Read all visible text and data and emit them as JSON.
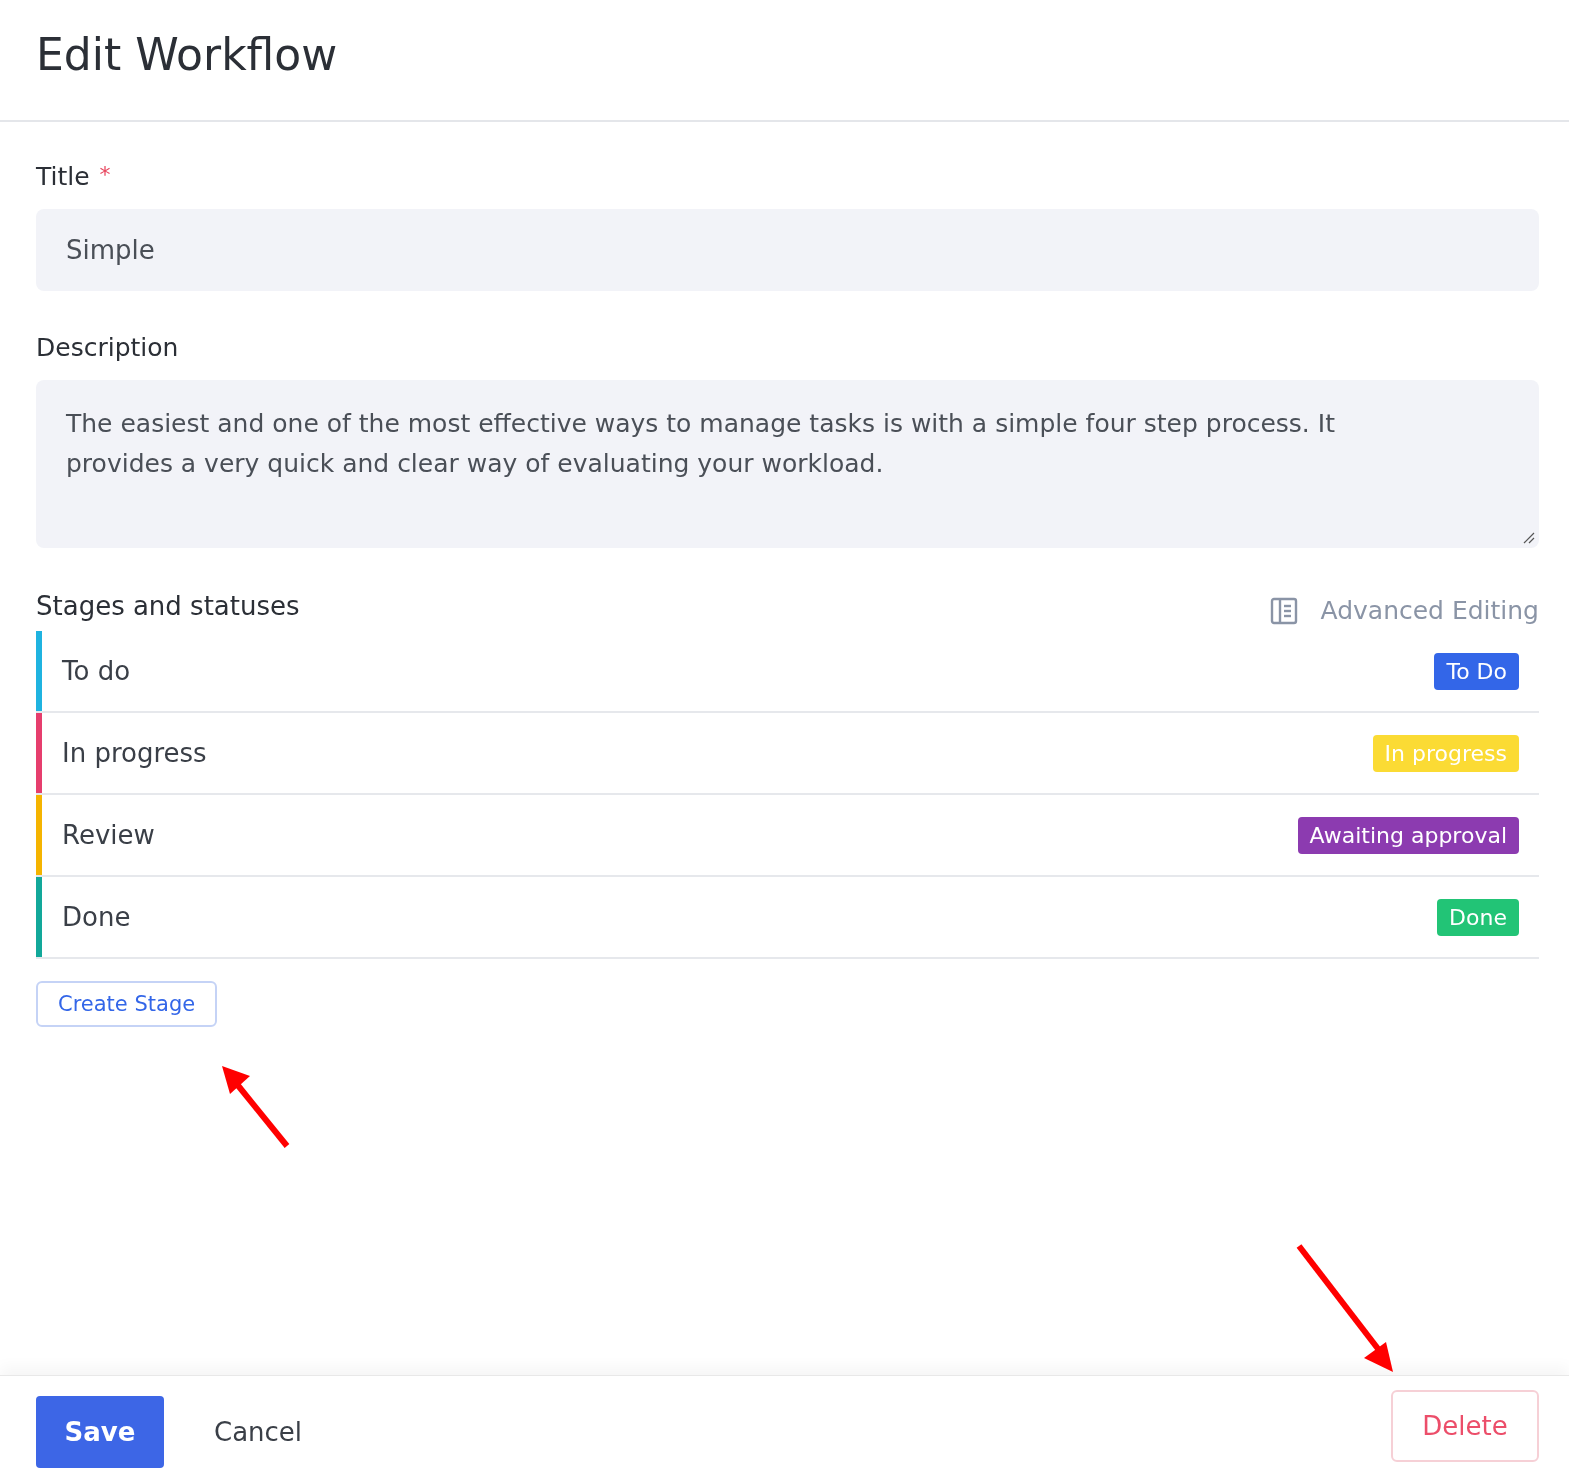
{
  "header": {
    "title": "Edit Workflow"
  },
  "title_field": {
    "label": "Title",
    "required_mark": "*",
    "value": "Simple"
  },
  "description_field": {
    "label": "Description",
    "value": "The easiest and one of the most effective ways to manage tasks is with a simple four step process. It provides a very quick and clear way of evaluating your workload."
  },
  "stages": {
    "heading": "Stages and statuses",
    "advanced_link": "Advanced Editing",
    "items": [
      {
        "name": "To do",
        "color": "#1fb3e0",
        "status": {
          "label": "To Do",
          "color": "#3366e8"
        }
      },
      {
        "name": "In progress",
        "color": "#e63e6d",
        "status": {
          "label": "In progress",
          "color": "#fbdb34"
        }
      },
      {
        "name": "Review",
        "color": "#f5b400",
        "status": {
          "label": "Awaiting approval",
          "color": "#8c3bb0"
        }
      },
      {
        "name": "Done",
        "color": "#12a89a",
        "status": {
          "label": "Done",
          "color": "#22c476"
        }
      }
    ],
    "create_button": "Create Stage"
  },
  "footer": {
    "save": "Save",
    "cancel": "Cancel",
    "delete": "Delete"
  }
}
